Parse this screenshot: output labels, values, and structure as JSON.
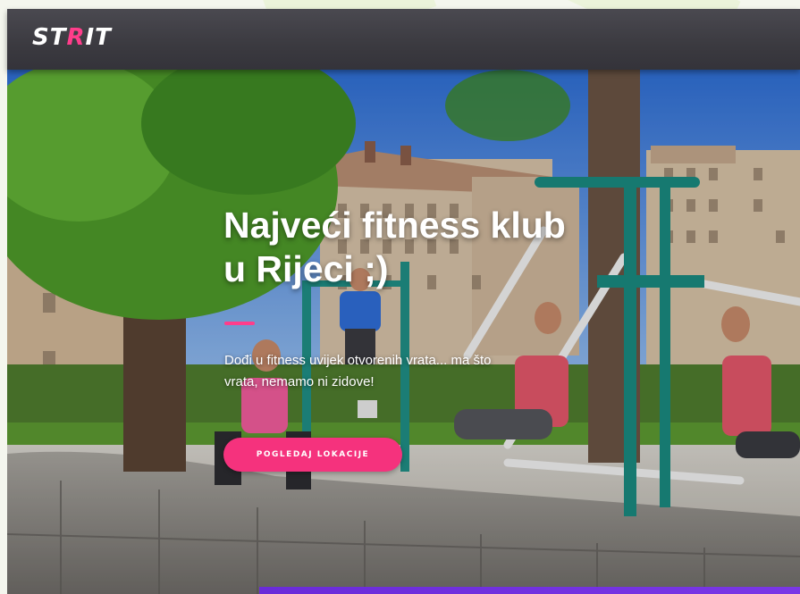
{
  "header": {
    "logo_text_part1": "ST",
    "logo_text_accent": "R",
    "logo_text_part2": "IT"
  },
  "hero": {
    "title_line1": "Najveći fitness klub",
    "title_line2": "u Rijeci ;)",
    "subtitle": "Dođi u fitness uvijek otvorenih vrata... ma što vrata, nemamo ni zidove!",
    "cta_label": "POGLEDAJ LOKACIJE"
  },
  "colors": {
    "header_bg": "#3b3a40",
    "accent_pink": "#ff3d8b",
    "button_pink": "#f5327d",
    "equipment_teal": "#1f8f86",
    "strip_purple": "#6a2bd9"
  }
}
